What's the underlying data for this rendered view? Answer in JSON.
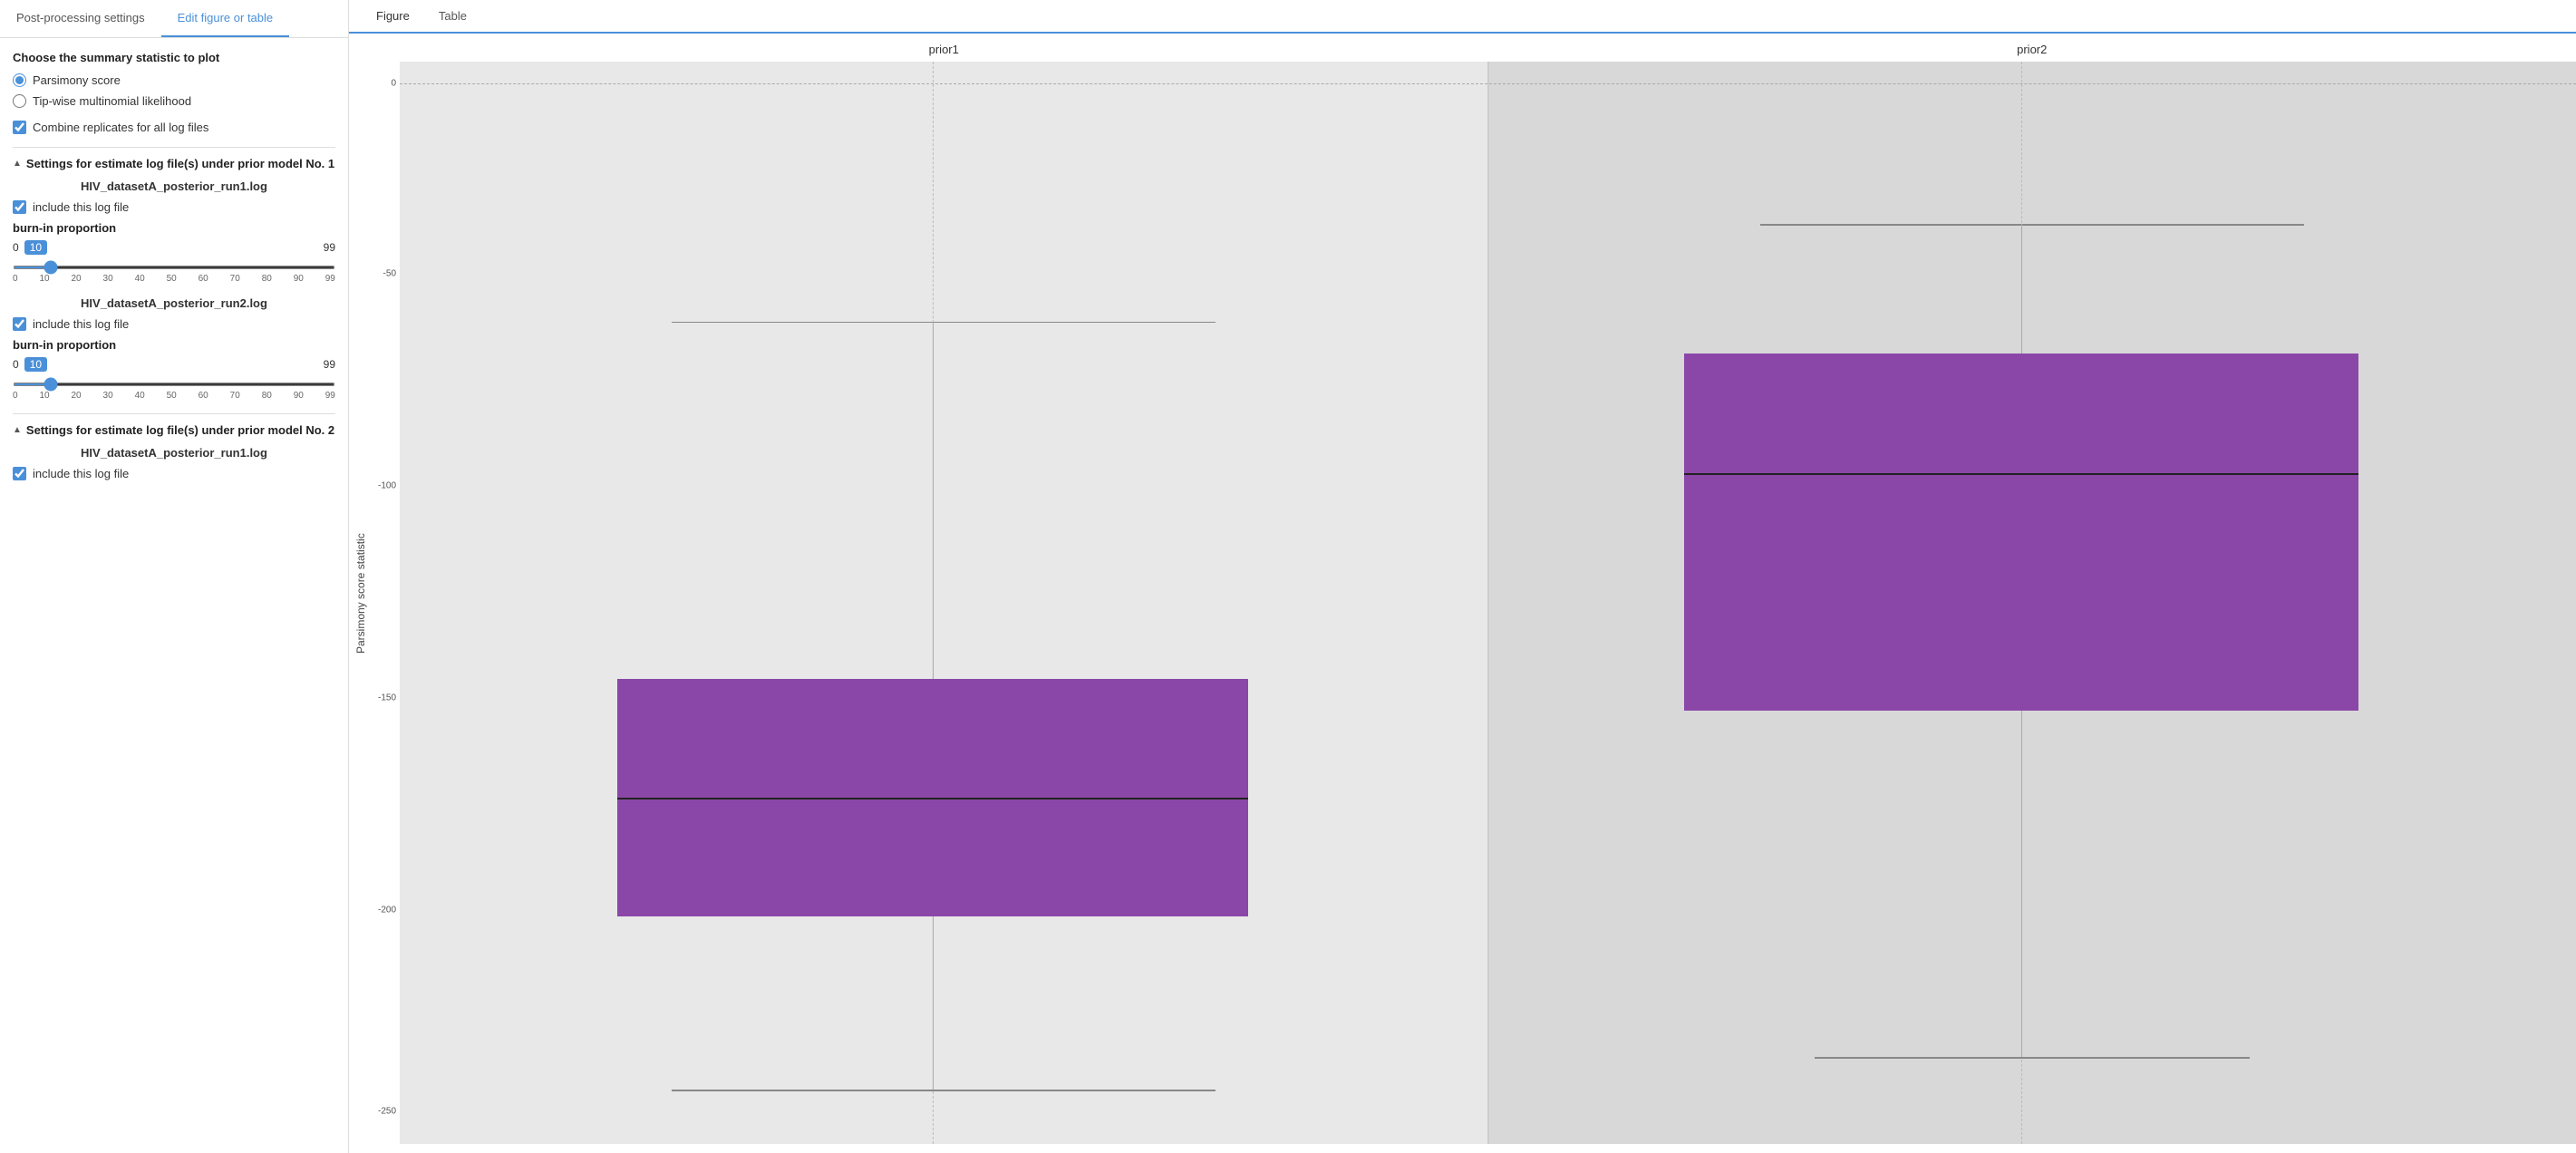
{
  "left_panel": {
    "tabs": [
      {
        "label": "Post-processing settings",
        "active": false
      },
      {
        "label": "Edit figure or table",
        "active": true
      }
    ],
    "section_title": "Choose the summary statistic to plot",
    "statistics": [
      {
        "label": "Parsimony score",
        "selected": true
      },
      {
        "label": "Tip-wise multinomial likelihood",
        "selected": false
      }
    ],
    "combine_replicates": {
      "label": "Combine replicates for all log files",
      "checked": true
    },
    "prior_sections": [
      {
        "header": "Settings for estimate log file(s) under prior model No. 1",
        "log_files": [
          {
            "name": "HIV_datasetA_posterior_run1.log",
            "include_checked": true,
            "include_label": "include this log file",
            "burn_in": {
              "label": "burn-in proportion",
              "min": 0,
              "max": 99,
              "value": 10,
              "ticks": [
                "0",
                "10",
                "20",
                "30",
                "40",
                "50",
                "60",
                "70",
                "80",
                "90",
                "99"
              ]
            }
          },
          {
            "name": "HIV_datasetA_posterior_run2.log",
            "include_checked": true,
            "include_label": "include this log file",
            "burn_in": {
              "label": "burn-in proportion",
              "min": 0,
              "max": 99,
              "value": 10,
              "ticks": [
                "0",
                "10",
                "20",
                "30",
                "40",
                "50",
                "60",
                "70",
                "80",
                "90",
                "99"
              ]
            }
          }
        ]
      },
      {
        "header": "Settings for estimate log file(s) under prior model No. 2",
        "log_files": [
          {
            "name": "HIV_datasetA_posterior_run1.log",
            "include_checked": true,
            "include_label": "include this log file"
          }
        ]
      }
    ]
  },
  "right_panel": {
    "tabs": [
      {
        "label": "Figure",
        "active": true
      },
      {
        "label": "Table",
        "active": false
      }
    ],
    "chart": {
      "y_axis_label": "Parsimony score statistic",
      "y_ticks": [
        {
          "label": "0",
          "pct": 0
        },
        {
          "label": "-50",
          "pct": 19.6
        },
        {
          "label": "-100",
          "pct": 39.2
        },
        {
          "label": "-150",
          "pct": 58.8
        },
        {
          "label": "-200",
          "pct": 78.4
        },
        {
          "label": "-250",
          "pct": 98
        }
      ],
      "panels": [
        {
          "id": "prior1",
          "label": "prior1",
          "box": {
            "whisker_top_pct": 24,
            "q1_pct": 57,
            "median_pct": 68,
            "q3_pct": 79,
            "whisker_bottom_pct": 95,
            "left_pct": 20,
            "right_pct": 78
          },
          "vert_dashed_pct": 49
        },
        {
          "id": "prior2",
          "label": "prior2",
          "box": {
            "whisker_top_pct": 15,
            "q1_pct": 27,
            "median_pct": 38,
            "q3_pct": 60,
            "whisker_bottom_pct": 92,
            "left_pct": 18,
            "right_pct": 80
          },
          "vert_dashed_pct": 49
        }
      ],
      "ref_line_pct": 2
    }
  }
}
